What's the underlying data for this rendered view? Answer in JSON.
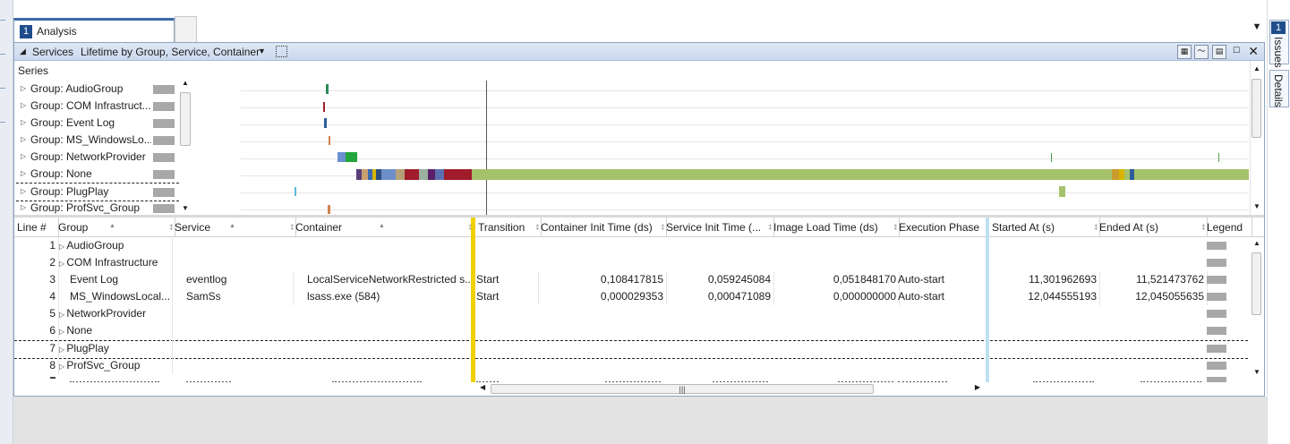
{
  "window": {
    "tab_number": "1",
    "tab_title": "Analysis",
    "menu_glyph": "▼"
  },
  "right_rail": {
    "issues_badge": "1",
    "issues_label": "Issues",
    "details_label": "Details"
  },
  "panel": {
    "section_label": "Services",
    "preset_label": "Lifetime by Group, Service, Container",
    "close_glyph": "✕"
  },
  "series": {
    "header": "Series",
    "items": [
      {
        "label": "Group: AudioGroup"
      },
      {
        "label": "Group: COM Infrastruct..."
      },
      {
        "label": "Group: Event Log"
      },
      {
        "label": "Group: MS_WindowsLo..."
      },
      {
        "label": "Group: NetworkProvider"
      },
      {
        "label": "Group: None"
      },
      {
        "label": "Group: PlugPlay"
      },
      {
        "label": "Group: ProfSvc_Group"
      }
    ]
  },
  "table": {
    "columns": [
      "Line #",
      "Group",
      "Service",
      "Container",
      "Transition",
      "Container Init Time (ds)",
      "Service Init Time (...",
      "Image Load Time (ds)",
      "Execution Phase",
      "Started At (s)",
      "Ended At (s)",
      "Legend"
    ],
    "rows": [
      {
        "line": "1",
        "expand": true,
        "group": "AudioGroup",
        "service": "",
        "container": "",
        "transition": "",
        "cinit": "",
        "sinit": "",
        "iload": "",
        "phase": "",
        "start": "",
        "end": ""
      },
      {
        "line": "2",
        "expand": true,
        "group": "COM Infrastructure",
        "service": "",
        "container": "",
        "transition": "",
        "cinit": "",
        "sinit": "",
        "iload": "",
        "phase": "",
        "start": "",
        "end": ""
      },
      {
        "line": "3",
        "expand": false,
        "group": "Event Log",
        "service": "eventlog",
        "container": "LocalServiceNetworkRestricted s...",
        "transition": "Start",
        "cinit": "0,108417815",
        "sinit": "0,059245084",
        "iload": "0,051848170",
        "phase": "Auto-start",
        "start": "11,301962693",
        "end": "11,521473762"
      },
      {
        "line": "4",
        "expand": false,
        "group": "MS_WindowsLocal...",
        "service": "SamSs",
        "container": "lsass.exe (584)",
        "transition": "Start",
        "cinit": "0,000029353",
        "sinit": "0,000471089",
        "iload": "0,000000000",
        "phase": "Auto-start",
        "start": "12,044555193",
        "end": "12,045055635"
      },
      {
        "line": "5",
        "expand": true,
        "group": "NetworkProvider",
        "service": "",
        "container": "",
        "transition": "",
        "cinit": "",
        "sinit": "",
        "iload": "",
        "phase": "",
        "start": "",
        "end": ""
      },
      {
        "line": "6",
        "expand": true,
        "group": "None",
        "service": "",
        "container": "",
        "transition": "",
        "cinit": "",
        "sinit": "",
        "iload": "",
        "phase": "",
        "start": "",
        "end": ""
      },
      {
        "line": "7",
        "expand": true,
        "group": "PlugPlay",
        "service": "",
        "container": "",
        "transition": "",
        "cinit": "",
        "sinit": "",
        "iload": "",
        "phase": "",
        "start": "",
        "end": ""
      },
      {
        "line": "8",
        "expand": true,
        "group": "ProfSvc_Group",
        "service": "",
        "container": "",
        "transition": "",
        "cinit": "",
        "sinit": "",
        "iload": "",
        "phase": "",
        "start": "",
        "end": ""
      }
    ]
  },
  "colors": {
    "accent": "#1f4d8c",
    "highlight_column": "#f0d000",
    "pinned_column": "#bfe0f0"
  }
}
